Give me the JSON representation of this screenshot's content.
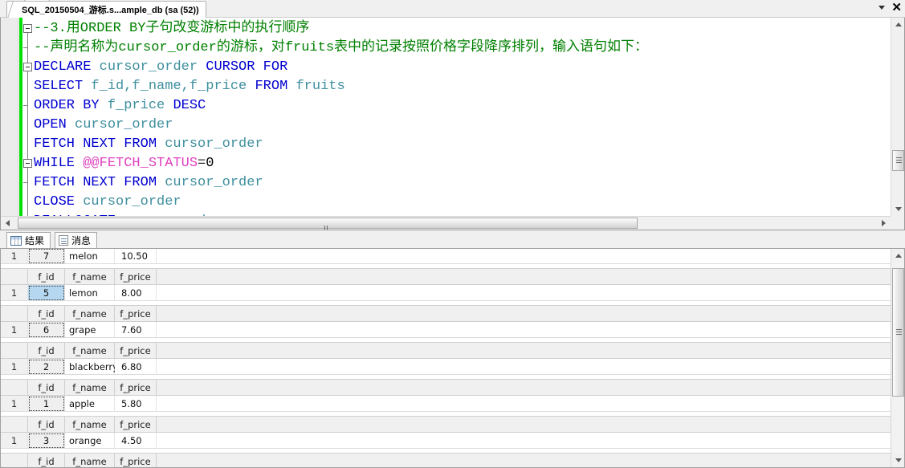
{
  "window": {
    "tab_title": "SQL_20150504_游标.s...ample_db (sa (52))",
    "dropdown_icon": "chevron-down-icon",
    "close_icon": "close-icon"
  },
  "editor": {
    "lines": [
      {
        "fold": "box",
        "tokens": [
          {
            "t": "--3.用ORDER BY子句改变游标中的执行顺序",
            "c": "cmt"
          }
        ]
      },
      {
        "fold": "tick",
        "tokens": [
          {
            "t": "--声明名称为cursor_order的游标，对fruits表中的记录按照价格字段降序排列，输入语句如下：",
            "c": "cmt"
          }
        ]
      },
      {
        "fold": "box",
        "tokens": [
          {
            "t": "DECLARE ",
            "c": "kw"
          },
          {
            "t": "cursor_order ",
            "c": "id"
          },
          {
            "t": "CURSOR FOR",
            "c": "kw"
          }
        ]
      },
      {
        "fold": "none",
        "tokens": [
          {
            "t": " SELECT ",
            "c": "kw"
          },
          {
            "t": "f_id,f_name,f_price ",
            "c": "id"
          },
          {
            "t": "FROM ",
            "c": "kw"
          },
          {
            "t": "fruits",
            "c": "id"
          }
        ]
      },
      {
        "fold": "tick",
        "tokens": [
          {
            "t": "ORDER BY ",
            "c": "kw"
          },
          {
            "t": "f_price ",
            "c": "id"
          },
          {
            "t": "DESC",
            "c": "kw"
          }
        ]
      },
      {
        "fold": "none",
        "tokens": [
          {
            "t": " OPEN ",
            "c": "kw"
          },
          {
            "t": "cursor_order",
            "c": "id"
          }
        ]
      },
      {
        "fold": "none",
        "tokens": [
          {
            "t": " FETCH NEXT FROM ",
            "c": "kw"
          },
          {
            "t": "cursor_order",
            "c": "id"
          }
        ]
      },
      {
        "fold": "box",
        "tokens": [
          {
            "t": "WHILE ",
            "c": "kw"
          },
          {
            "t": " @@FETCH_STATUS",
            "c": "fn"
          },
          {
            "t": "=",
            "c": "op"
          },
          {
            "t": "0",
            "c": "num"
          }
        ]
      },
      {
        "fold": "tick",
        "tokens": [
          {
            "t": "FETCH NEXT FROM ",
            "c": "kw"
          },
          {
            "t": "cursor_order",
            "c": "id"
          }
        ]
      },
      {
        "fold": "none",
        "tokens": [
          {
            "t": " CLOSE ",
            "c": "kw"
          },
          {
            "t": "cursor_order",
            "c": "id"
          }
        ]
      },
      {
        "fold": "none",
        "tokens": [
          {
            "t": " DEALLOCATE ",
            "c": "kw"
          },
          {
            "t": "cursor_order;",
            "c": "id"
          }
        ]
      }
    ]
  },
  "results": {
    "tabs": [
      {
        "label": "结果",
        "icon": "results-grid-icon",
        "active": true
      },
      {
        "label": "消息",
        "icon": "messages-icon",
        "active": false
      }
    ],
    "columns": [
      "f_id",
      "f_name",
      "f_price"
    ],
    "row_header": "1",
    "result_sets": [
      {
        "show_header": false,
        "f_id": "7",
        "f_name": "melon",
        "f_price": "10.50",
        "selected": false
      },
      {
        "show_header": true,
        "f_id": "5",
        "f_name": "lemon",
        "f_price": "8.00",
        "selected": true
      },
      {
        "show_header": true,
        "f_id": "6",
        "f_name": "grape",
        "f_price": "7.60",
        "selected": false
      },
      {
        "show_header": true,
        "f_id": "2",
        "f_name": "blackberry",
        "f_price": "6.80",
        "selected": false
      },
      {
        "show_header": true,
        "f_id": "1",
        "f_name": "apple",
        "f_price": "5.80",
        "selected": false
      },
      {
        "show_header": true,
        "f_id": "3",
        "f_name": "orange",
        "f_price": "4.50",
        "selected": false
      },
      {
        "show_header": true,
        "f_id": "",
        "f_name": "",
        "f_price": "",
        "selected": false
      }
    ]
  },
  "colors": {
    "comment": "#008000",
    "keyword": "#0000d0",
    "identifier": "#3f8f9f",
    "function": "#e040c0",
    "change_bar": "#00e000",
    "selection": "#b5d7f0"
  }
}
